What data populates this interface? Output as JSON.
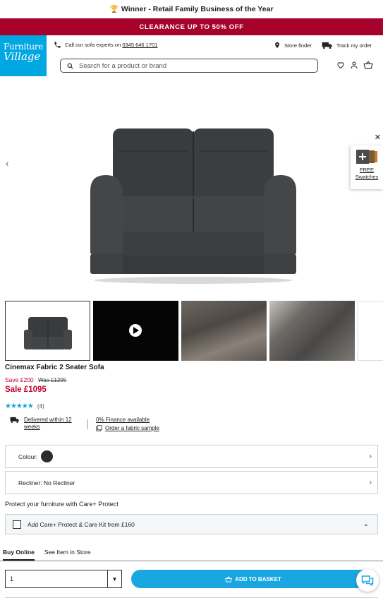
{
  "topbar": {
    "award_text": "Winner - Retail Family Business of the Year"
  },
  "promo": {
    "text": "CLEARANCE UP TO 50% OFF"
  },
  "header": {
    "logo_line1": "Furniture",
    "logo_line2": "Village",
    "call_prefix": "Call our ",
    "call_bold": "sofa experts",
    "call_on": " on ",
    "phone": "0345 646 1701",
    "store_finder": "Store finder",
    "track_order": "Track my order",
    "search_placeholder": "Search for a product or brand"
  },
  "swatches": {
    "line1": "FREE",
    "line2": "Swatches"
  },
  "product": {
    "name": "Cinemax Fabric 2 Seater Sofa",
    "save": "Save £200",
    "was": "Was £1295",
    "sale": "Sale £1095",
    "rating_value": 4.5,
    "review_count": "(4)",
    "delivery": "Delivered within 12 weeks",
    "finance": "0% Finance available",
    "fabric_sample": "Order a fabric sample"
  },
  "options": {
    "colour_label": "Colour:",
    "colour_value_color": "#2b2b2b",
    "recliner_label": "Recliner: No Recliner"
  },
  "care": {
    "title": "Protect your furniture with Care+ Protect",
    "option": "Add Care+ Protect & Care Kit from £160"
  },
  "tabs": [
    "Buy Online",
    "See Item in Store"
  ],
  "purchase": {
    "quantity": "1",
    "add_label": "ADD TO BASKET"
  },
  "colors": {
    "promo": "#a6022b",
    "brand_blue": "#00a7e1",
    "sale_red": "#c4002f"
  }
}
